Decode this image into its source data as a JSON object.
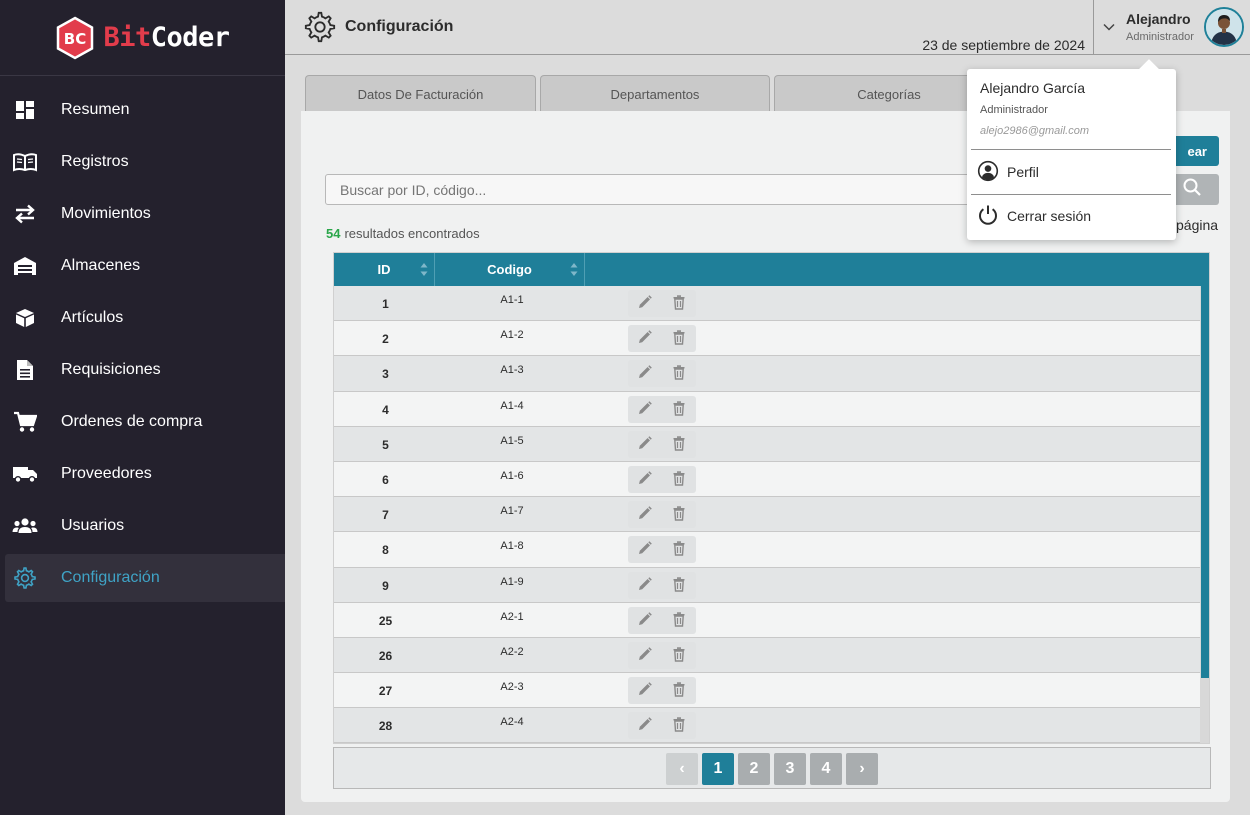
{
  "brand": {
    "logo_letters": "BC",
    "name_part1": "Bit",
    "name_part2": "Coder"
  },
  "sidebar": {
    "items": [
      {
        "label": "Resumen",
        "icon": "dashboard-icon"
      },
      {
        "label": "Registros",
        "icon": "book-icon"
      },
      {
        "label": "Movimientos",
        "icon": "transfer-icon"
      },
      {
        "label": "Almacenes",
        "icon": "warehouse-icon"
      },
      {
        "label": "Artículos",
        "icon": "box-icon"
      },
      {
        "label": "Requisiciones",
        "icon": "document-icon"
      },
      {
        "label": "Ordenes de compra",
        "icon": "cart-icon"
      },
      {
        "label": "Proveedores",
        "icon": "truck-icon"
      },
      {
        "label": "Usuarios",
        "icon": "users-icon"
      },
      {
        "label": "Configuración",
        "icon": "gear-icon",
        "active": true
      }
    ]
  },
  "header": {
    "title": "Configuración",
    "date": "23 de septiembre de 2024",
    "user_name": "Alejandro",
    "user_role": "Administrador"
  },
  "tabs": [
    {
      "label": "Datos De Facturación"
    },
    {
      "label": "Departamentos"
    },
    {
      "label": "Categorías"
    }
  ],
  "toolbar": {
    "create_label": "ear",
    "search_placeholder": "Buscar por ID, código...",
    "results_count": "54",
    "results_label": "resultados encontrados",
    "per_page_label": "página"
  },
  "table": {
    "columns": [
      "ID",
      "Codigo"
    ],
    "rows": [
      {
        "id": "1",
        "code": "A1-1"
      },
      {
        "id": "2",
        "code": "A1-2"
      },
      {
        "id": "3",
        "code": "A1-3"
      },
      {
        "id": "4",
        "code": "A1-4"
      },
      {
        "id": "5",
        "code": "A1-5"
      },
      {
        "id": "6",
        "code": "A1-6"
      },
      {
        "id": "7",
        "code": "A1-7"
      },
      {
        "id": "8",
        "code": "A1-8"
      },
      {
        "id": "9",
        "code": "A1-9"
      },
      {
        "id": "25",
        "code": "A2-1"
      },
      {
        "id": "26",
        "code": "A2-2"
      },
      {
        "id": "27",
        "code": "A2-3"
      },
      {
        "id": "28",
        "code": "A2-4"
      }
    ]
  },
  "pagination": {
    "pages": [
      "1",
      "2",
      "3",
      "4"
    ],
    "current": "1",
    "prev": "‹",
    "next": "›"
  },
  "user_menu": {
    "full_name": "Alejandro García",
    "role": "Administrador",
    "email": "alejo2986@gmail.com",
    "profile_label": "Perfil",
    "logout_label": "Cerrar sesión"
  },
  "colors": {
    "accent": "#1f7f99",
    "sidebar_bg": "#24212d",
    "brand_red": "#e23c4b",
    "active_nav": "#3fa3c6",
    "results_green": "#2aa64a"
  }
}
